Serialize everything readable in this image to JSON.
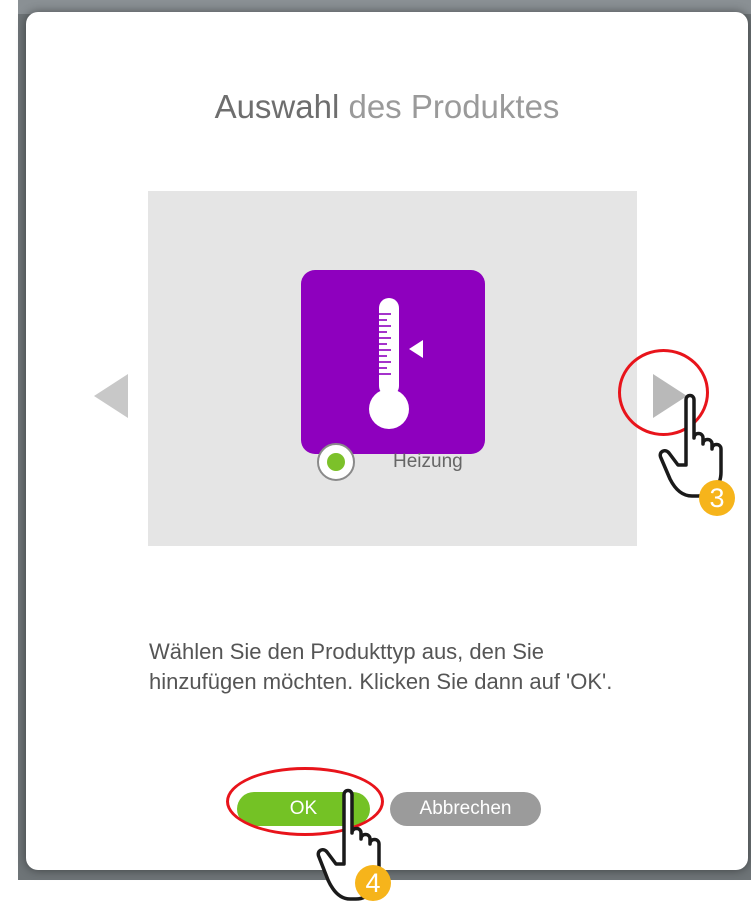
{
  "dialog": {
    "title_strong": "Auswahl",
    "title_rest": "des Produktes"
  },
  "product": {
    "icon": "thermometer-icon",
    "icon_bg": "#8e00be",
    "label": "Heizung",
    "selected": true
  },
  "carousel": {
    "prev_icon": "triangle-left-icon",
    "next_icon": "triangle-right-icon"
  },
  "instruction": "Wählen Sie den Produkttyp aus, den Sie hinzufügen möchten. Klicken Sie dann auf 'OK'.",
  "buttons": {
    "ok": "OK",
    "cancel": "Abbrechen"
  },
  "annotations": {
    "step_next": "3",
    "step_ok": "4",
    "highlight_color": "#e8141b",
    "badge_color": "#f6b41b"
  },
  "colors": {
    "accent_green": "#74c225",
    "cancel_gray": "#9b9b9b"
  }
}
